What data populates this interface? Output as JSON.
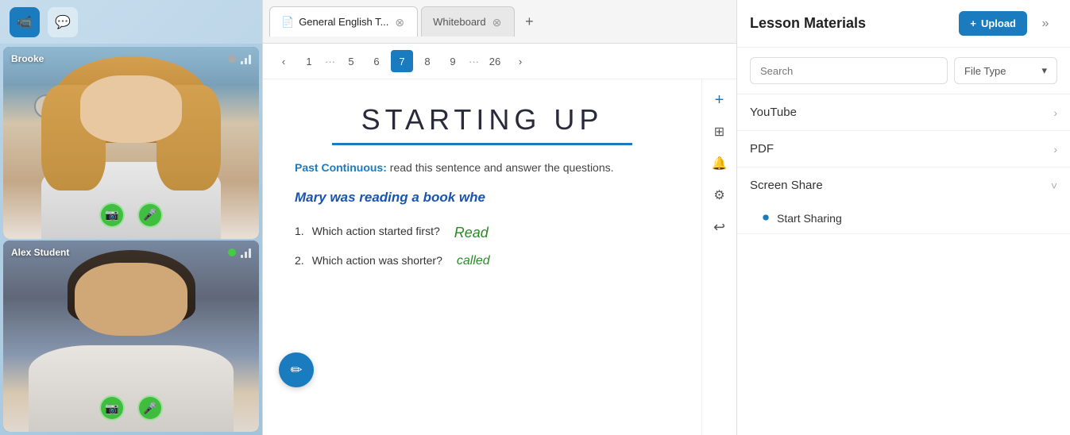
{
  "topbar": {
    "video_btn_label": "📹",
    "chat_btn_label": "💬"
  },
  "participants": [
    {
      "name": "Brooke",
      "subtitle": "",
      "mic_on": true,
      "cam_on": true,
      "signal": 3
    },
    {
      "name": "Alex Student",
      "subtitle": "",
      "mic_on": true,
      "cam_on": true,
      "signal": 3
    }
  ],
  "tabs": [
    {
      "label": "General English T...",
      "icon": "📄",
      "active": true,
      "closable": true
    },
    {
      "label": "Whiteboard",
      "icon": "",
      "active": false,
      "closable": true
    }
  ],
  "tab_add_label": "+",
  "pagination": {
    "pages": [
      "1",
      "...",
      "5",
      "6",
      "7",
      "8",
      "9",
      "...",
      "26"
    ],
    "active_page": "7",
    "prev_label": "‹",
    "next_label": "›"
  },
  "document": {
    "title": "STARTING UP",
    "instruction_prefix": "Past Continuous:",
    "instruction_text": " read this sentence and answer the questions.",
    "sentence": "Mary was reading a book whe",
    "questions": [
      {
        "number": "1.",
        "text": "Which action started first?",
        "answer": "Read"
      },
      {
        "number": "2.",
        "text": "Which action was shorter?",
        "answer": "called"
      }
    ]
  },
  "toolbar_icons": [
    {
      "name": "plus",
      "symbol": "+"
    },
    {
      "name": "layers",
      "symbol": "⊞"
    },
    {
      "name": "bell",
      "symbol": "🔔"
    },
    {
      "name": "gear",
      "symbol": "⚙"
    },
    {
      "name": "history",
      "symbol": "↩"
    }
  ],
  "floating_pencil": "✏",
  "right_panel": {
    "title": "Lesson Materials",
    "upload_label": "+ Upload",
    "collapse_label": "»",
    "search_placeholder": "Search",
    "file_type_label": "File Type",
    "materials": [
      {
        "label": "YouTube",
        "expanded": false
      },
      {
        "label": "PDF",
        "expanded": false
      },
      {
        "label": "Screen Share",
        "expanded": true
      }
    ],
    "screen_share_sub": {
      "label": "Start Sharing"
    }
  }
}
